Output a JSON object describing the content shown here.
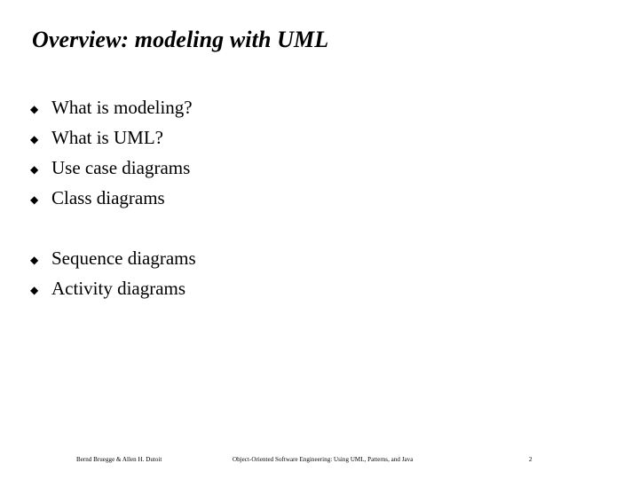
{
  "slide": {
    "title": "Overview: modeling with UML",
    "background_color": "#ffffff",
    "text_color": "#000000",
    "bullet_glyph": "◆",
    "groups": [
      {
        "items": [
          {
            "label": "What is modeling?"
          },
          {
            "label": "What is UML?"
          },
          {
            "label": "Use case diagrams"
          },
          {
            "label": "Class diagrams"
          }
        ]
      },
      {
        "items": [
          {
            "label": "Sequence diagrams"
          },
          {
            "label": "Activity diagrams"
          }
        ]
      }
    ]
  },
  "footer": {
    "authors": "Bernd Bruegge & Allen H. Dutoit",
    "source": "Object-Oriented Software Engineering: Using UML, Patterns, and Java",
    "page_number": "2"
  }
}
